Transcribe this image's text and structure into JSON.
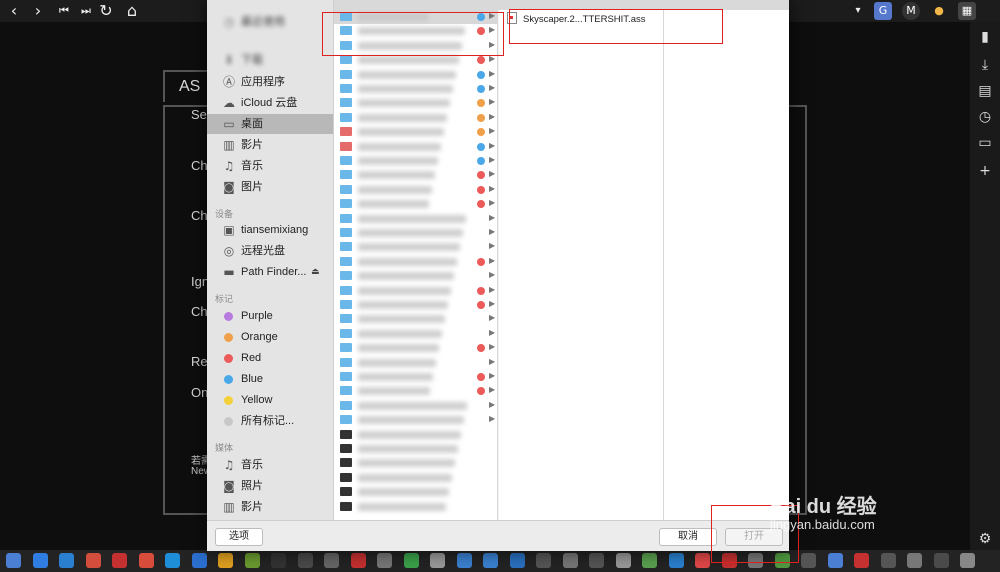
{
  "browser": {
    "icons": [
      "back-icon",
      "forward-icon",
      "skip-back-icon",
      "skip-forward-icon",
      "reload-icon",
      "home-icon"
    ],
    "sidebar_icons": [
      "bookmark-icon",
      "download-icon",
      "notes-icon",
      "history-icon",
      "window-icon",
      "add-icon",
      "settings-icon"
    ]
  },
  "background": {
    "heading": "AS",
    "labels": [
      "Se",
      "Ch",
      "Ch",
      "Ign",
      "Ch",
      "Re",
      "On"
    ],
    "small_lines": [
      "若需",
      "New"
    ]
  },
  "dialog": {
    "sidebar": {
      "top_blurred": [
        "最近使用",
        "下载"
      ],
      "favorites": [
        {
          "icon": "apps-icon",
          "label": "应用程序"
        },
        {
          "icon": "cloud-icon",
          "label": "iCloud 云盘"
        },
        {
          "icon": "desktop-icon",
          "label": "桌面",
          "selected": true
        },
        {
          "icon": "film-icon",
          "label": "影片"
        },
        {
          "icon": "music-icon",
          "label": "音乐"
        },
        {
          "icon": "camera-icon",
          "label": "图片"
        }
      ],
      "devices_heading": "设备",
      "devices": [
        {
          "icon": "hdd-icon",
          "label": "tiansemixiang"
        },
        {
          "icon": "disc-icon",
          "label": "远程光盘"
        },
        {
          "icon": "drive-icon",
          "label": "Path Finder..."
        }
      ],
      "tags_heading": "标记",
      "tags": [
        {
          "label": "Purple",
          "color": "#b77be0"
        },
        {
          "label": "Orange",
          "color": "#f0a04a"
        },
        {
          "label": "Red",
          "color": "#ec5a5a"
        },
        {
          "label": "Blue",
          "color": "#4aa8e8"
        },
        {
          "label": "Yellow",
          "color": "#f4d13b"
        },
        {
          "label": "所有标记...",
          "color": "#c8c8c8"
        }
      ],
      "media_heading": "媒体",
      "media": [
        {
          "icon": "music-icon",
          "label": "音乐"
        },
        {
          "icon": "camera-icon",
          "label": "照片"
        },
        {
          "icon": "film-icon",
          "label": "影片"
        }
      ]
    },
    "column1": {
      "row_tags": [
        "#4aa8e8",
        "#ec5a5a",
        "",
        "#ec5a5a",
        "#4aa8e8",
        "#4aa8e8",
        "#f0a04a",
        "#f0a04a",
        "#f0a04a",
        "#4aa8e8",
        "#4aa8e8",
        "#ec5a5a",
        "#ec5a5a",
        "#ec5a5a",
        "",
        "",
        "",
        "#ec5a5a",
        "",
        "#ec5a5a",
        "#ec5a5a",
        "",
        "",
        "#ec5a5a",
        "",
        "#ec5a5a",
        "#ec5a5a",
        "",
        "",
        "",
        "",
        "",
        "",
        "",
        ""
      ]
    },
    "column2": {
      "file_name": "Skyscaper.2...TTERSHIT.ass"
    },
    "buttons": {
      "options": "选项",
      "cancel": "取消",
      "open": "打开"
    }
  },
  "watermark": {
    "brand": "Bai du 经验",
    "url": "jingyan.baidu.com"
  }
}
